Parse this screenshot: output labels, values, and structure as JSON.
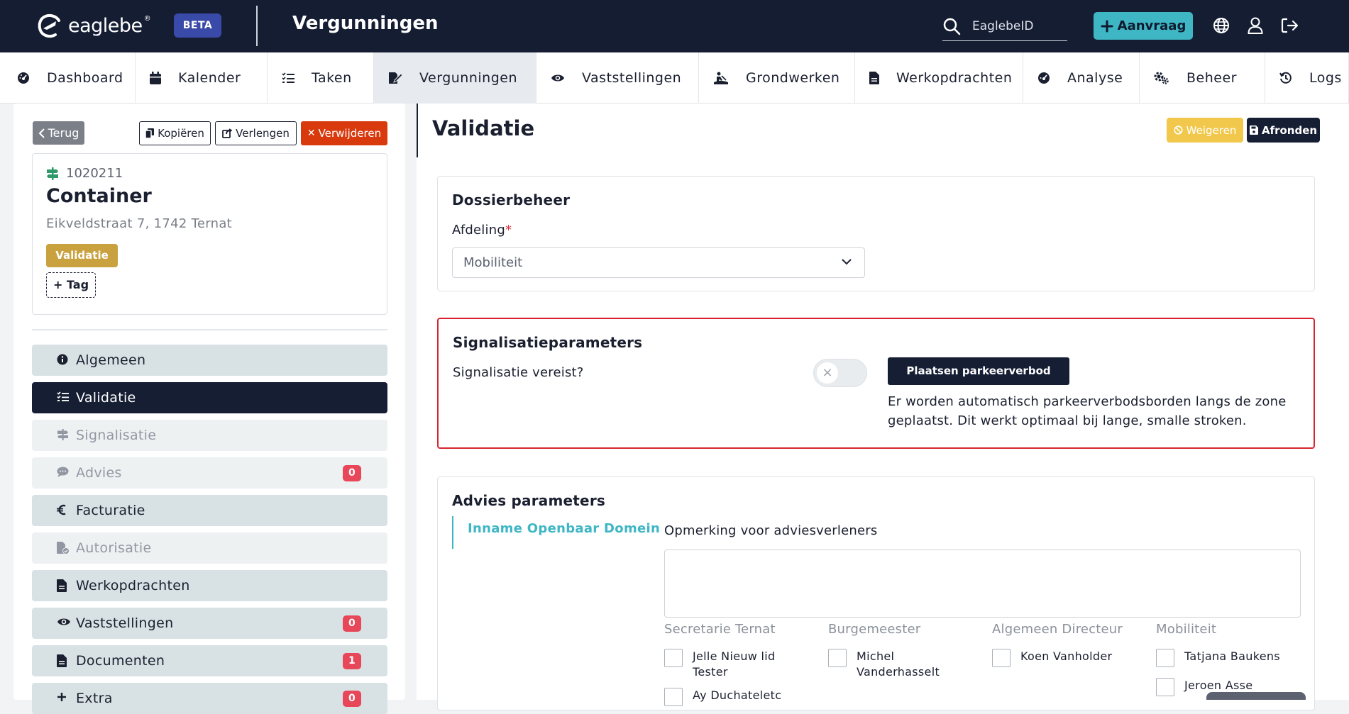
{
  "header": {
    "logo_text": "eaglebe",
    "beta_label": "BETA",
    "app_title": "Vergunningen",
    "search_placeholder": "EaglebeID",
    "aanvraag_label": "Aanvraag"
  },
  "nav": [
    {
      "label": "Dashboard",
      "icon": "dashboard-icon",
      "width": 191
    },
    {
      "label": "Kalender",
      "icon": "calendar-icon",
      "width": 186
    },
    {
      "label": "Taken",
      "icon": "tasks-icon",
      "width": 150
    },
    {
      "label": "Vergunningen",
      "icon": "permit-icon",
      "width": 229,
      "active": true
    },
    {
      "label": "Vaststellingen",
      "icon": "eye-icon",
      "width": 229
    },
    {
      "label": "Grondwerken",
      "icon": "excavation-icon",
      "width": 220
    },
    {
      "label": "Werkopdrachten",
      "icon": "file-icon",
      "width": 237
    },
    {
      "label": "Analyse",
      "icon": "analysis-icon",
      "width": 164
    },
    {
      "label": "Beheer",
      "icon": "gears-icon",
      "width": 177
    },
    {
      "label": "Logs",
      "icon": "history-icon",
      "width": 118
    }
  ],
  "left": {
    "back_label": "Terug",
    "copy_label": "Kopiëren",
    "extend_label": "Verlengen",
    "delete_label": "Verwijderen",
    "dossier_id": "1020211",
    "dossier_title": "Container",
    "address": "Eikveldstraat 7, 1742 Ternat",
    "status_badge": "Validatie",
    "tag_label": "+ Tag",
    "menu": [
      {
        "label": "Algemeen",
        "state": "normal",
        "icon": "info-icon"
      },
      {
        "label": "Validatie",
        "state": "active",
        "icon": "checklist-icon"
      },
      {
        "label": "Signalisatie",
        "state": "disabled",
        "icon": "signpost-icon"
      },
      {
        "label": "Advies",
        "state": "disabled",
        "icon": "comment-icon",
        "count": "0"
      },
      {
        "label": "Facturatie",
        "state": "normal",
        "icon": "euro-icon"
      },
      {
        "label": "Autorisatie",
        "state": "disabled",
        "icon": "authorization-icon"
      },
      {
        "label": "Werkopdrachten",
        "state": "normal",
        "icon": "file-icon"
      },
      {
        "label": "Vaststellingen",
        "state": "normal",
        "icon": "eye-icon",
        "count": "0"
      },
      {
        "label": "Documenten",
        "state": "normal",
        "icon": "file-icon",
        "count": "1"
      },
      {
        "label": "Extra",
        "state": "normal",
        "icon": "plus-icon",
        "count": "0"
      }
    ]
  },
  "main": {
    "title": "Validatie",
    "reject_label": "Weigeren",
    "finish_label": "Afronden",
    "dossierbeheer": {
      "title": "Dossierbeheer",
      "afdeling_label": "Afdeling",
      "required_mark": "*",
      "afdeling_value": "Mobiliteit"
    },
    "signalisatie": {
      "title": "Signalisatieparameters",
      "question": "Signalisatie vereist?",
      "toggle_state": "×",
      "parking_button": "Plaatsen parkeerverbod",
      "parking_description": "Er worden automatisch parkeerverbodsborden langs de zone geplaatst. Dit werkt optimaal bij lange, smalle stroken."
    },
    "advies": {
      "title": "Advies parameters",
      "tab_label": "Inname Openbaar Domein",
      "remark_label": "Opmerking voor adviesverleners",
      "groups": [
        {
          "name": "Secretarie Ternat",
          "members": [
            "Jelle Nieuw lid Tester",
            "Ay Duchateletc"
          ]
        },
        {
          "name": "Burgemeester",
          "members": [
            "Michel Vanderhasselt"
          ]
        },
        {
          "name": "Algemeen Directeur",
          "members": [
            "Koen Vanholder"
          ]
        },
        {
          "name": "Mobiliteit",
          "members": [
            "Tatjana Baukens",
            "Jeroen Asse"
          ]
        }
      ]
    }
  },
  "colors": {
    "header_bg": "#151d33",
    "accent": "#3eb6c4",
    "danger": "#d83a0e",
    "warning": "#f1c84b",
    "status_gold": "#c9a13e",
    "badge_red": "#e8475a"
  }
}
